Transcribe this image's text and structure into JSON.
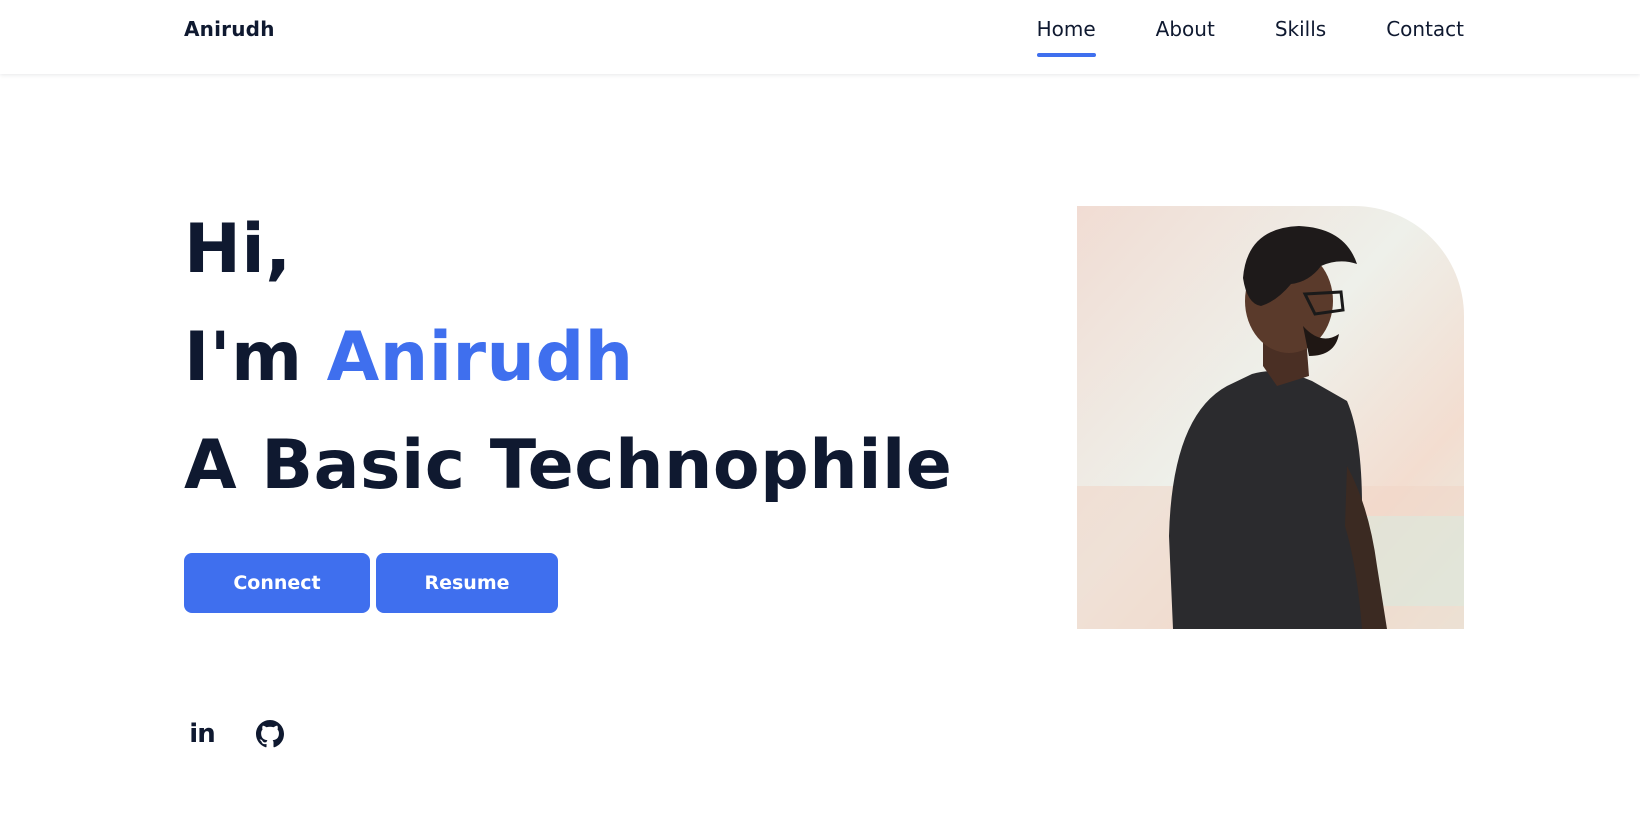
{
  "header": {
    "logo": "Anirudh",
    "nav": [
      {
        "label": "Home",
        "active": true
      },
      {
        "label": "About",
        "active": false
      },
      {
        "label": "Skills",
        "active": false
      },
      {
        "label": "Contact",
        "active": false
      }
    ]
  },
  "hero": {
    "greeting": "Hi,",
    "intro_prefix": "I'm ",
    "name": "Anirudh",
    "tagline": "A Basic Technophile",
    "buttons": {
      "connect": "Connect",
      "resume": "Resume"
    },
    "social": [
      {
        "icon": "linkedin-icon",
        "glyph": "in"
      },
      {
        "icon": "github-icon"
      }
    ]
  },
  "portrait": {
    "icon": "profile-photo"
  },
  "colors": {
    "accent": "#3f6fee",
    "text": "#0f1930",
    "background": "#ffffff"
  }
}
